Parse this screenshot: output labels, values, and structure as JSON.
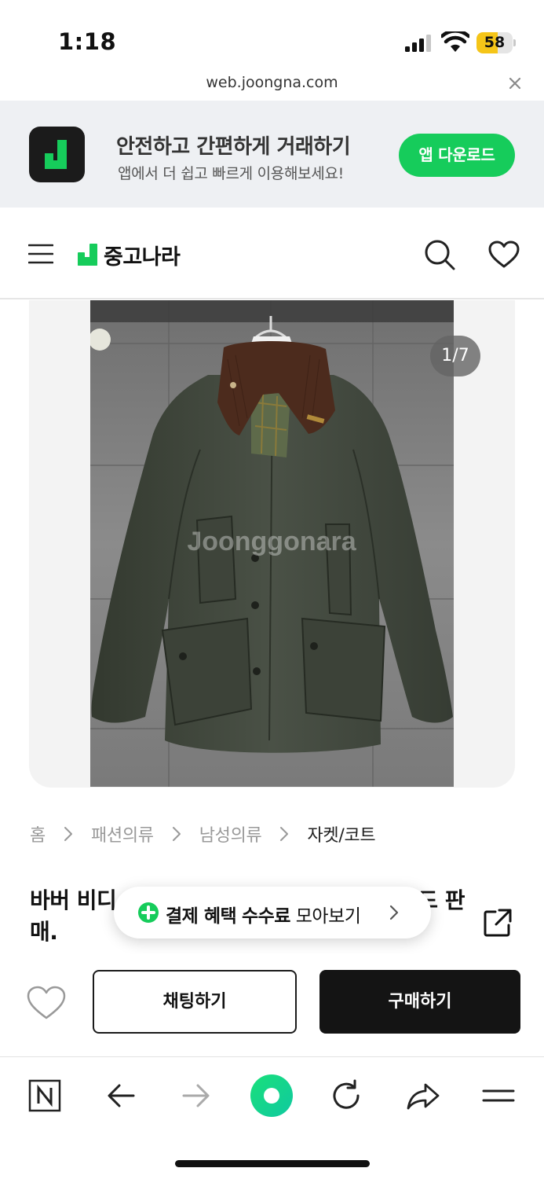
{
  "status_bar": {
    "time": "1:18",
    "battery": "58",
    "battery_level": 0.58
  },
  "browser": {
    "url": "web.joongna.com"
  },
  "app_banner": {
    "title": "안전하고 간편하게 거래하기",
    "subtitle": "앱에서 더 쉽고 빠르게 이용해보세요!",
    "download_label": "앱 다운로드",
    "accent_color": "#16cc5b"
  },
  "header": {
    "brand": "중고나라"
  },
  "gallery": {
    "counter": "1/7",
    "watermark": "Joonggonara"
  },
  "breadcrumb": {
    "home": "홈",
    "level1": "패션의류",
    "level2": "남성의류",
    "level3": "자켓/코트"
  },
  "product": {
    "title_start": "바버 비디",
    "title_end": "드 판",
    "title_line2": "매."
  },
  "benefit_banner": {
    "part1": "결제 혜택",
    "part2": "수수료",
    "part3": "모아보기"
  },
  "actions": {
    "chat_label": "채팅하기",
    "buy_label": "구매하기"
  }
}
